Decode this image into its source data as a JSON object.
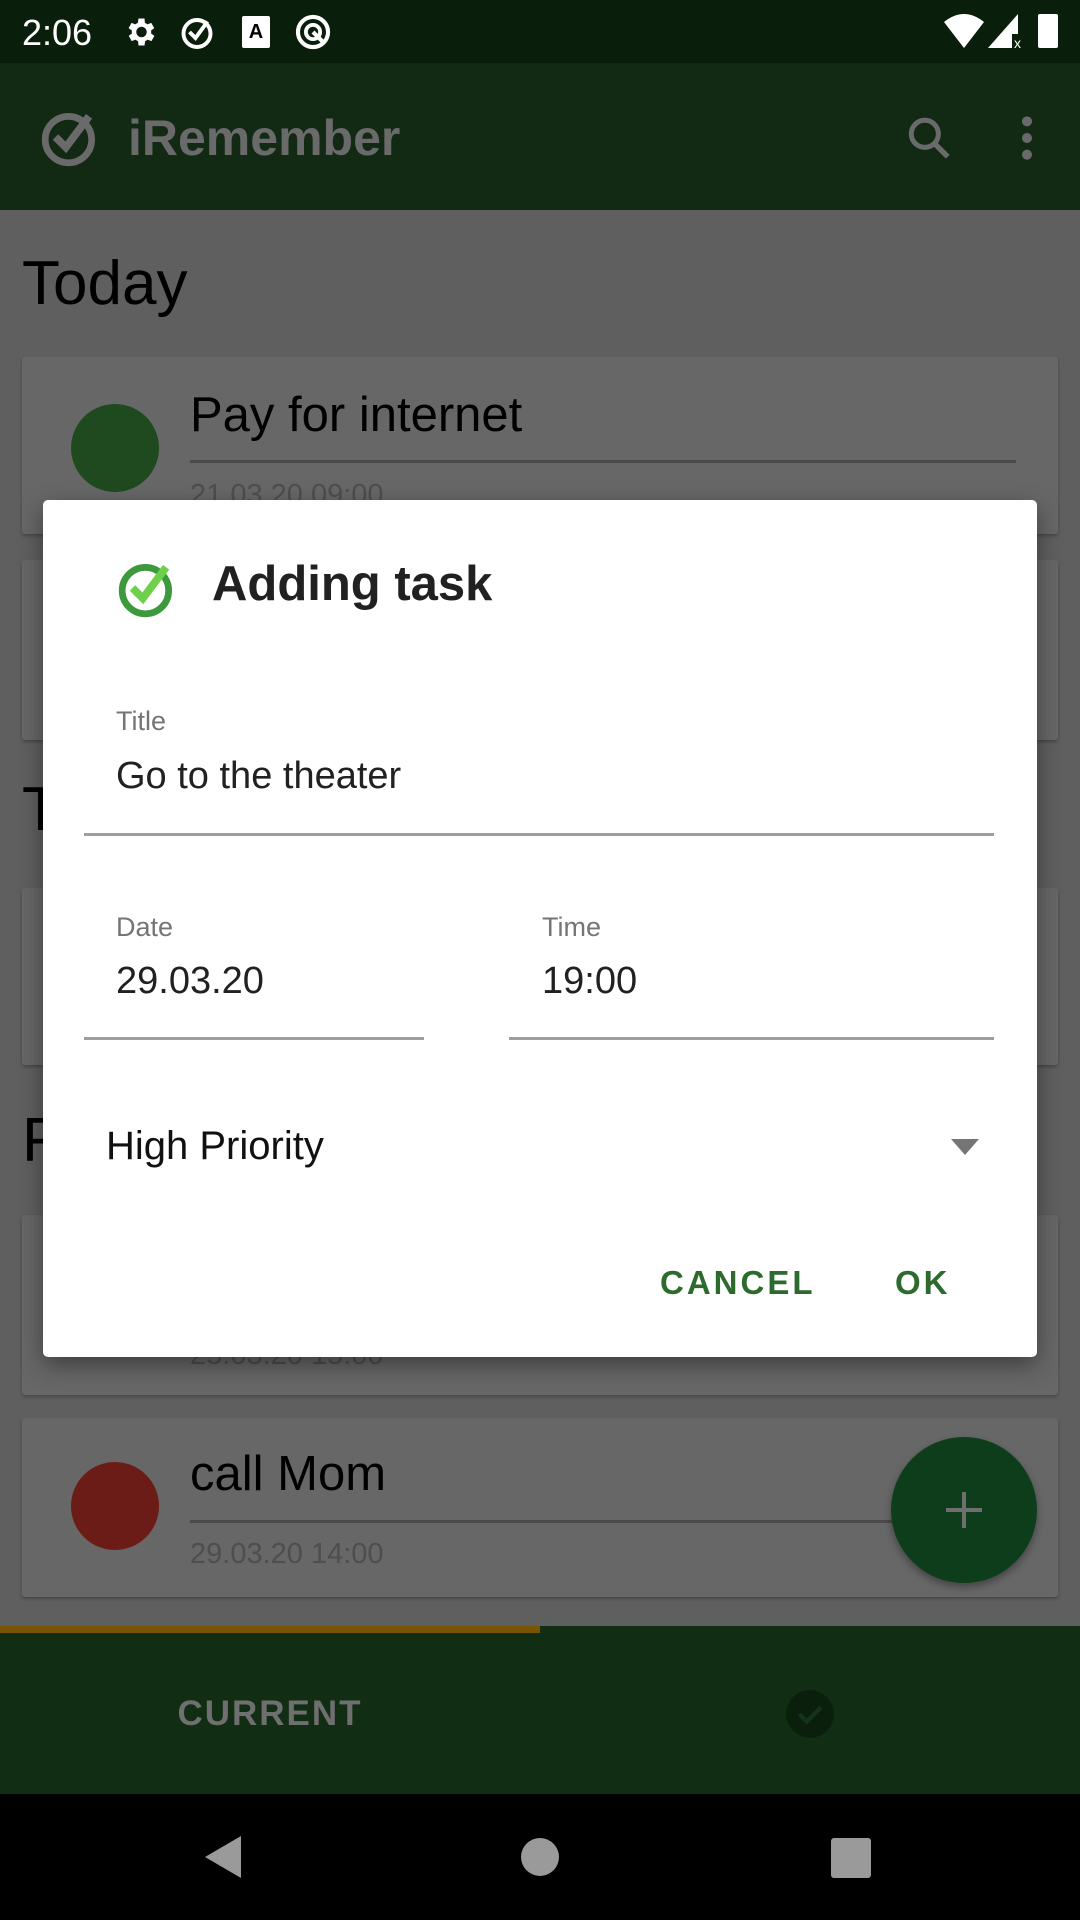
{
  "status_bar": {
    "time": "2:06",
    "left_icons": [
      "gear-icon",
      "check-circle-icon",
      "text-a-icon",
      "q-icon"
    ],
    "right_icons": [
      "wifi-icon",
      "signal-icon",
      "battery-icon"
    ]
  },
  "toolbar": {
    "title": "iRemember",
    "icons": [
      "app-logo-check-icon",
      "search-icon",
      "more-vert-icon"
    ]
  },
  "sections": [
    {
      "heading": "Today"
    },
    {
      "heading": "T"
    },
    {
      "heading": "F"
    }
  ],
  "tasks": [
    {
      "title": "Pay for internet",
      "datetime": "21.03.20 09:00",
      "priority_color": "#1f4a1f"
    },
    {
      "title": "",
      "datetime": "25.03.20 15:00"
    },
    {
      "title": "call Mom",
      "datetime": "29.03.20 14:00",
      "priority_color": "#6b1c16"
    }
  ],
  "dialog": {
    "title": "Adding task",
    "title_field": {
      "label": "Title",
      "value": "Go to the theater"
    },
    "date_field": {
      "label": "Date",
      "value": "29.03.20"
    },
    "time_field": {
      "label": "Time",
      "value": "19:00"
    },
    "priority": {
      "selected": "High Priority"
    },
    "cancel_label": "CANCEL",
    "ok_label": "OK",
    "accent": "#2c6a2e"
  },
  "fab": {
    "icon": "plus-icon"
  },
  "tabs": [
    {
      "label": "CURRENT",
      "selected": true
    },
    {
      "icon": "check-circle-icon"
    }
  ],
  "colors": {
    "primary": "#1b5e20",
    "tab_indicator": "#ffb300"
  }
}
